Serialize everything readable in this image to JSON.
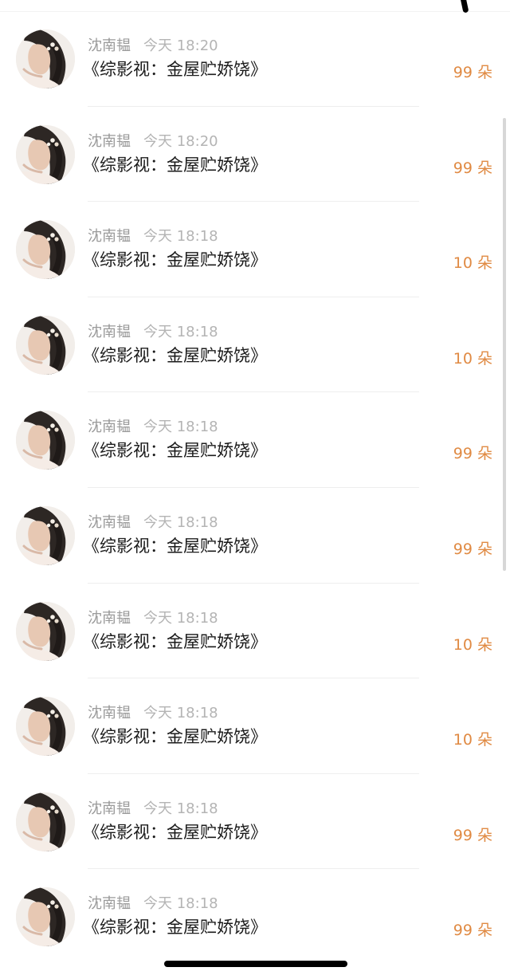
{
  "list": {
    "items": [
      {
        "name": "沈南韫",
        "time": "今天 18:20",
        "title": "《综影视：金屋贮娇饶》",
        "gift": "99 朵"
      },
      {
        "name": "沈南韫",
        "time": "今天 18:20",
        "title": "《综影视：金屋贮娇饶》",
        "gift": "99 朵"
      },
      {
        "name": "沈南韫",
        "time": "今天 18:18",
        "title": "《综影视：金屋贮娇饶》",
        "gift": "10 朵"
      },
      {
        "name": "沈南韫",
        "time": "今天 18:18",
        "title": "《综影视：金屋贮娇饶》",
        "gift": "10 朵"
      },
      {
        "name": "沈南韫",
        "time": "今天 18:18",
        "title": "《综影视：金屋贮娇饶》",
        "gift": "99 朵"
      },
      {
        "name": "沈南韫",
        "time": "今天 18:18",
        "title": "《综影视：金屋贮娇饶》",
        "gift": "99 朵"
      },
      {
        "name": "沈南韫",
        "time": "今天 18:18",
        "title": "《综影视：金屋贮娇饶》",
        "gift": "10 朵"
      },
      {
        "name": "沈南韫",
        "time": "今天 18:18",
        "title": "《综影视：金屋贮娇饶》",
        "gift": "10 朵"
      },
      {
        "name": "沈南韫",
        "time": "今天 18:18",
        "title": "《综影视：金屋贮娇饶》",
        "gift": "99 朵"
      },
      {
        "name": "沈南韫",
        "time": "今天 18:18",
        "title": "《综影视：金屋贮娇饶》",
        "gift": "99 朵"
      }
    ]
  },
  "theme": {
    "accent": "#e08a43",
    "name_color": "#9a9a9a",
    "time_color": "#b4b4b4",
    "title_color": "#1b1b1b"
  },
  "icons": {
    "avatar": "avatar-photo"
  }
}
